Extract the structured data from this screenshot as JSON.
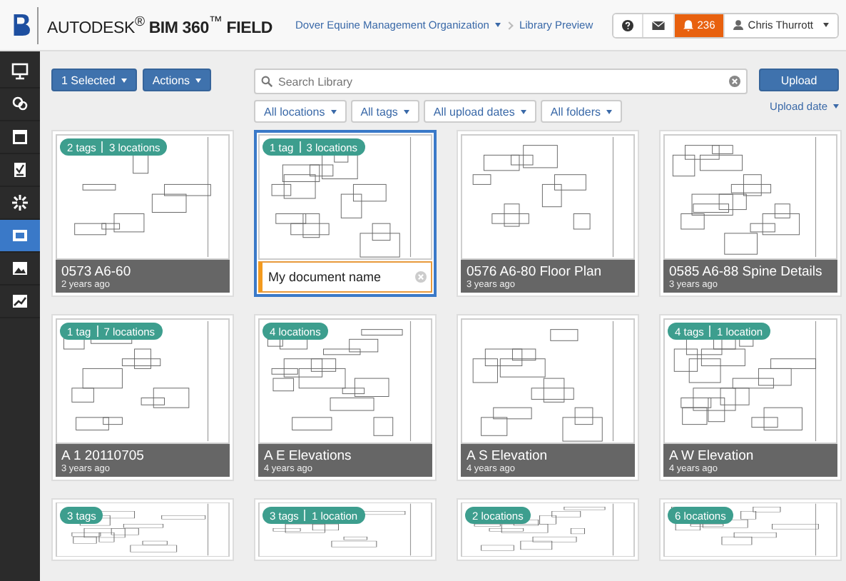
{
  "header": {
    "product": "AUTODESK$^{®}$ **BIM 360**$^{™}$ **FIELD**",
    "breadcrumb": [
      {
        "label": "Dover Equine Management Organization",
        "dropdown": true
      },
      {
        "label": "Library Preview",
        "dropdown": false
      }
    ],
    "notifications": "236",
    "user": "Chris Thurrott"
  },
  "sidebar": {
    "items": [
      {
        "selected": false
      },
      {
        "selected": false
      },
      {
        "selected": false
      },
      {
        "selected": false
      },
      {
        "selected": false
      },
      {
        "selected": true
      },
      {
        "selected": false
      },
      {
        "selected": false
      }
    ]
  },
  "toolbar": {
    "selection": "1 Selected",
    "actions": "Actions",
    "search": {
      "placeholder": "Search Library"
    },
    "filters": [
      "All locations",
      "All tags",
      "All upload dates",
      "All folders"
    ],
    "upload": "Upload",
    "sort": "Upload date"
  },
  "cards": [
    {
      "tags": [
        "2 tags",
        "3 locations"
      ],
      "title": "0573 A6-60",
      "age": "2 years ago",
      "selected": false
    },
    {
      "tags": [
        "1 tag",
        "3 locations"
      ],
      "title_field": {
        "value": "My document name"
      },
      "selected": true
    },
    {
      "title": "0576 A6-80 Floor Plan",
      "age": "3 years ago",
      "selected": false
    },
    {
      "title": "0585 A6-88 Spine Details",
      "age": "3 years ago",
      "selected": false
    },
    {
      "tags": [
        "1 tag",
        "7 locations"
      ],
      "title": "A 1 20110705",
      "age": "3 years ago",
      "selected": false
    },
    {
      "tags": [
        "4 locations"
      ],
      "title": "A E Elevations",
      "age": "4 years ago",
      "selected": false
    },
    {
      "title": "A S Elevation",
      "age": "4 years ago",
      "selected": false
    },
    {
      "tags": [
        "4 tags",
        "1 location"
      ],
      "title": "A W Elevation",
      "age": "4 years ago",
      "selected": false
    },
    {
      "tags": [
        "3 tags"
      ],
      "selected": false
    },
    {
      "tags": [
        "3 tags",
        "1 location"
      ],
      "selected": false
    },
    {
      "tags": [
        "2 locations"
      ],
      "selected": false
    },
    {
      "tags": [
        "6 locations"
      ],
      "selected": false
    }
  ]
}
